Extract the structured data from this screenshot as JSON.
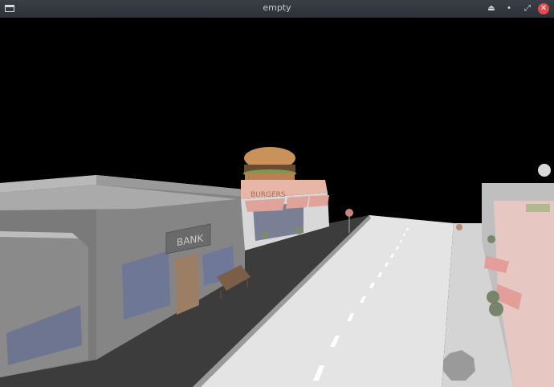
{
  "window": {
    "title": "empty",
    "app_icon": "window-icon",
    "controls": {
      "minimize": "⏏",
      "restore": "•",
      "maximize": "⤢",
      "close": "✕"
    }
  },
  "scene": {
    "signs": {
      "bank": "BANK",
      "burger": "BURGERS"
    },
    "colors": {
      "sky": "#000000",
      "road": "#e6e6e6",
      "bank_wall": "#7e7e7e",
      "burger_bun": "#c9925a",
      "awning_stripe": "#e0a39a"
    }
  }
}
